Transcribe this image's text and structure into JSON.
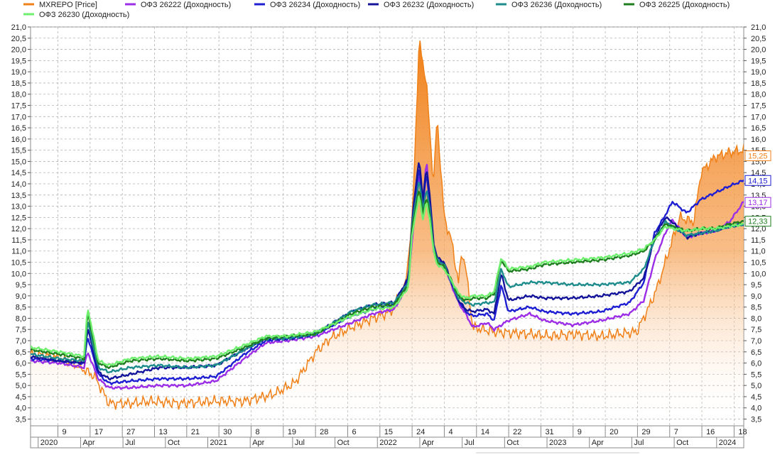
{
  "chart_data": {
    "type": "line",
    "legend": {
      "placement": "top",
      "items": [
        {
          "name": "MXREPO [Price]",
          "color": "#f08018"
        },
        {
          "name": "ОФЗ 26222 (Доходность)",
          "color": "#9b2ee6"
        },
        {
          "name": "ОФЗ 26234 (Доходность)",
          "color": "#1e1ed2"
        },
        {
          "name": "ОФЗ 26232 (Доходность)",
          "color": "#14149b"
        },
        {
          "name": "ОФЗ 26236 (Доходность)",
          "color": "#1e8c8c"
        },
        {
          "name": "ОФЗ 26225 (Доходность)",
          "color": "#1e7d1e"
        },
        {
          "name": "ОФЗ 26230 (Доходность)",
          "color": "#6ef06e"
        }
      ]
    },
    "y_axis": {
      "min": 3.2,
      "max": 21.0,
      "step": 0.5,
      "ticks": [
        "21,0",
        "20,5",
        "20,0",
        "19,5",
        "19,0",
        "18,5",
        "18,0",
        "17,5",
        "17,0",
        "16,5",
        "16,0",
        "15,5",
        "15,0",
        "14,5",
        "14,0",
        "13,5",
        "13,0",
        "12,5",
        "12,0",
        "11,5",
        "11,0",
        "10,5",
        "10,0",
        "9,5",
        "9,0",
        "8,5",
        "8,0",
        "7,5",
        "7,0",
        "6,5",
        "6,0",
        "5,5",
        "5,0",
        "4,5",
        "4,0",
        "3,5"
      ]
    },
    "x_axis": {
      "ticks_top": [
        "9",
        "17",
        "27",
        "13",
        "21",
        "30",
        "8",
        "19",
        "28",
        "6",
        "15",
        "24",
        "4",
        "14",
        "22",
        "31",
        "9",
        "20",
        "29",
        "7",
        "16",
        "18"
      ],
      "ticks_bottom": [
        "2020",
        "Apr",
        "Jul",
        "Oct",
        "2021",
        "Apr",
        "Jul",
        "Oct",
        "2022",
        "Apr",
        "Jul",
        "Oct",
        "2023",
        "Apr",
        "Jul",
        "Oct",
        "2024"
      ]
    },
    "grid": true,
    "series": [
      {
        "name": "MXREPO [Price]",
        "style": "area-gradient",
        "color": "#f08018",
        "t": [
          0,
          0.03,
          0.06,
          0.09,
          0.11,
          0.14,
          0.17,
          0.21,
          0.26,
          0.3,
          0.34,
          0.37,
          0.4,
          0.42,
          0.45,
          0.48,
          0.505,
          0.525,
          0.535,
          0.545,
          0.555,
          0.565,
          0.57,
          0.58,
          0.59,
          0.6,
          0.605,
          0.61,
          0.62,
          0.65,
          0.7,
          0.73,
          0.76,
          0.8,
          0.85,
          0.87,
          0.88,
          0.9,
          0.91,
          0.93,
          0.94,
          0.96,
          0.98,
          1.0
        ],
        "values": [
          6.4,
          6.3,
          6.0,
          5.4,
          4.2,
          4.2,
          4.3,
          4.2,
          4.3,
          4.3,
          4.6,
          5.1,
          6.5,
          7.1,
          7.6,
          8.0,
          8.3,
          9.4,
          12.3,
          20.4,
          18.5,
          14.0,
          17.0,
          12.5,
          11.5,
          9.6,
          11.0,
          10.3,
          7.6,
          7.4,
          7.3,
          7.2,
          7.3,
          7.2,
          7.4,
          8.7,
          9.5,
          11.5,
          12.5,
          12.3,
          14.5,
          15.2,
          15.4,
          15.5
        ]
      },
      {
        "name": "ОФЗ 26222 (Доходность)",
        "color": "#9b2ee6",
        "t": [
          0,
          0.04,
          0.075,
          0.08,
          0.095,
          0.11,
          0.14,
          0.18,
          0.22,
          0.26,
          0.3,
          0.33,
          0.36,
          0.4,
          0.45,
          0.48,
          0.51,
          0.53,
          0.535,
          0.545,
          0.55,
          0.555,
          0.56,
          0.565,
          0.57,
          0.58,
          0.59,
          0.6,
          0.61,
          0.62,
          0.64,
          0.65,
          0.67,
          0.7,
          0.72,
          0.76,
          0.8,
          0.84,
          0.86,
          0.875,
          0.89,
          0.9,
          0.92,
          0.94,
          0.96,
          0.98,
          1.0
        ],
        "values": [
          6.1,
          6.0,
          5.8,
          6.5,
          5.3,
          4.9,
          4.9,
          5.0,
          5.0,
          5.2,
          6.2,
          6.9,
          7.0,
          7.2,
          7.8,
          8.2,
          8.4,
          9.5,
          11.5,
          14.5,
          12.5,
          15.2,
          13.0,
          11.0,
          10.5,
          10.3,
          9.5,
          8.7,
          8.2,
          7.6,
          7.8,
          7.5,
          7.9,
          8.2,
          7.9,
          7.7,
          7.9,
          8.2,
          8.8,
          10.6,
          11.8,
          12.4,
          11.6,
          11.8,
          11.9,
          12.3,
          13.2
        ]
      },
      {
        "name": "ОФЗ 26234 (Доходность)",
        "color": "#1e1ed2",
        "t": [
          0,
          0.04,
          0.075,
          0.08,
          0.095,
          0.11,
          0.14,
          0.18,
          0.22,
          0.26,
          0.3,
          0.33,
          0.36,
          0.4,
          0.45,
          0.48,
          0.51,
          0.53,
          0.535,
          0.545,
          0.55,
          0.555,
          0.56,
          0.565,
          0.57,
          0.58,
          0.59,
          0.6,
          0.61,
          0.62,
          0.64,
          0.65,
          0.66,
          0.67,
          0.7,
          0.72,
          0.76,
          0.8,
          0.84,
          0.86,
          0.875,
          0.89,
          0.9,
          0.92,
          0.94,
          0.96,
          0.98,
          1.0
        ],
        "values": [
          6.2,
          6.1,
          6.0,
          7.2,
          5.5,
          5.1,
          5.2,
          5.3,
          5.3,
          5.4,
          6.4,
          7.0,
          7.1,
          7.3,
          8.1,
          8.4,
          8.6,
          9.8,
          12.0,
          14.8,
          13.0,
          14.5,
          13.2,
          11.2,
          10.6,
          10.4,
          9.6,
          8.8,
          8.3,
          8.1,
          8.2,
          7.9,
          9.5,
          8.3,
          8.5,
          8.3,
          8.2,
          8.3,
          8.7,
          9.6,
          11.8,
          12.6,
          13.2,
          12.7,
          13.3,
          13.6,
          13.9,
          14.15
        ]
      },
      {
        "name": "ОФЗ 26232 (Доходность)",
        "color": "#14149b",
        "t": [
          0,
          0.04,
          0.075,
          0.08,
          0.095,
          0.11,
          0.14,
          0.18,
          0.22,
          0.26,
          0.3,
          0.33,
          0.36,
          0.4,
          0.45,
          0.48,
          0.51,
          0.53,
          0.535,
          0.545,
          0.55,
          0.555,
          0.56,
          0.565,
          0.57,
          0.58,
          0.59,
          0.6,
          0.61,
          0.62,
          0.64,
          0.65,
          0.66,
          0.67,
          0.7,
          0.72,
          0.76,
          0.8,
          0.84,
          0.86,
          0.875,
          0.89,
          0.9,
          0.92,
          0.94,
          0.96,
          0.98,
          1.0
        ],
        "values": [
          6.3,
          6.1,
          6.0,
          7.6,
          5.6,
          5.3,
          5.5,
          5.8,
          5.8,
          5.9,
          6.6,
          7.1,
          7.1,
          7.3,
          8.3,
          8.6,
          8.7,
          9.8,
          12.4,
          15.2,
          13.2,
          14.8,
          13.4,
          11.4,
          10.7,
          10.5,
          9.6,
          8.8,
          8.4,
          8.3,
          8.4,
          8.2,
          10.0,
          8.8,
          9.0,
          8.9,
          8.9,
          9.0,
          9.2,
          9.8,
          11.6,
          12.5,
          12.3,
          11.6,
          11.8,
          11.9,
          12.1,
          12.2
        ]
      },
      {
        "name": "ОФЗ 26236 (Доходность)",
        "color": "#1e8c8c",
        "t": [
          0,
          0.04,
          0.075,
          0.08,
          0.095,
          0.11,
          0.14,
          0.18,
          0.22,
          0.26,
          0.3,
          0.33,
          0.36,
          0.4,
          0.45,
          0.48,
          0.51,
          0.53,
          0.535,
          0.545,
          0.55,
          0.555,
          0.56,
          0.565,
          0.57,
          0.58,
          0.59,
          0.6,
          0.61,
          0.62,
          0.64,
          0.65,
          0.66,
          0.67,
          0.7,
          0.72,
          0.76,
          0.8,
          0.84,
          0.86,
          0.875,
          0.89,
          0.9,
          0.92,
          0.94,
          0.96,
          0.98,
          1.0
        ],
        "values": [
          6.4,
          6.2,
          6.1,
          7.9,
          5.8,
          5.6,
          5.8,
          5.9,
          5.8,
          5.9,
          6.6,
          7.1,
          7.1,
          7.3,
          8.3,
          8.6,
          8.7,
          9.6,
          12.2,
          14.2,
          12.8,
          13.8,
          12.8,
          11.2,
          10.6,
          10.4,
          9.6,
          8.9,
          8.7,
          8.6,
          8.7,
          8.7,
          10.2,
          9.4,
          9.6,
          9.6,
          9.5,
          9.5,
          9.6,
          10.2,
          11.5,
          12.3,
          12.1,
          11.7,
          11.8,
          11.9,
          12.1,
          12.2
        ]
      },
      {
        "name": "ОФЗ 26225 (Доходность)",
        "color": "#1e7d1e",
        "t": [
          0,
          0.04,
          0.075,
          0.08,
          0.095,
          0.11,
          0.14,
          0.18,
          0.22,
          0.26,
          0.3,
          0.33,
          0.36,
          0.4,
          0.45,
          0.48,
          0.51,
          0.53,
          0.535,
          0.545,
          0.55,
          0.555,
          0.56,
          0.565,
          0.57,
          0.58,
          0.59,
          0.6,
          0.61,
          0.62,
          0.64,
          0.65,
          0.66,
          0.67,
          0.7,
          0.72,
          0.76,
          0.8,
          0.84,
          0.86,
          0.875,
          0.89,
          0.9,
          0.92,
          0.94,
          0.96,
          0.98,
          1.0
        ],
        "values": [
          6.6,
          6.4,
          6.2,
          8.3,
          6.0,
          5.8,
          6.1,
          6.2,
          6.1,
          6.2,
          6.7,
          7.1,
          7.2,
          7.3,
          8.2,
          8.5,
          8.6,
          9.5,
          12.0,
          13.8,
          12.6,
          13.4,
          12.6,
          11.1,
          10.5,
          10.3,
          9.7,
          9.0,
          8.8,
          8.9,
          8.9,
          9.1,
          10.6,
          10.1,
          10.2,
          10.4,
          10.5,
          10.6,
          10.8,
          11.0,
          11.5,
          12.2,
          12.1,
          11.9,
          12.0,
          12.0,
          12.2,
          12.33
        ]
      },
      {
        "name": "ОФЗ 26230 (Доходность)",
        "color": "#6ef06e",
        "t": [
          0,
          0.04,
          0.075,
          0.08,
          0.095,
          0.11,
          0.14,
          0.18,
          0.22,
          0.26,
          0.3,
          0.33,
          0.36,
          0.4,
          0.45,
          0.48,
          0.51,
          0.53,
          0.535,
          0.545,
          0.55,
          0.555,
          0.56,
          0.565,
          0.57,
          0.58,
          0.59,
          0.6,
          0.61,
          0.62,
          0.64,
          0.65,
          0.66,
          0.67,
          0.7,
          0.72,
          0.76,
          0.8,
          0.84,
          0.86,
          0.875,
          0.89,
          0.9,
          0.92,
          0.94,
          0.96,
          0.98,
          1.0
        ],
        "values": [
          6.7,
          6.5,
          6.3,
          8.5,
          6.1,
          5.9,
          6.2,
          6.3,
          6.2,
          6.3,
          6.8,
          7.2,
          7.2,
          7.4,
          8.1,
          8.4,
          8.5,
          9.4,
          11.8,
          13.5,
          12.4,
          13.2,
          12.4,
          11.0,
          10.4,
          10.2,
          9.7,
          9.1,
          8.9,
          9.0,
          9.0,
          9.2,
          10.7,
          10.2,
          10.3,
          10.5,
          10.6,
          10.7,
          10.9,
          11.1,
          11.5,
          12.1,
          12.0,
          11.9,
          12.0,
          12.0,
          12.1,
          12.2
        ]
      }
    ],
    "last_value_labels": [
      {
        "text": "15,25",
        "value": 15.25,
        "color": "#f08018"
      },
      {
        "text": "14,15",
        "value": 14.15,
        "color": "#1e1ed2"
      },
      {
        "text": "13,17",
        "value": 13.17,
        "color": "#9b2ee6"
      },
      {
        "text": "12,33",
        "value": 12.33,
        "color": "#1e7d1e"
      }
    ]
  }
}
